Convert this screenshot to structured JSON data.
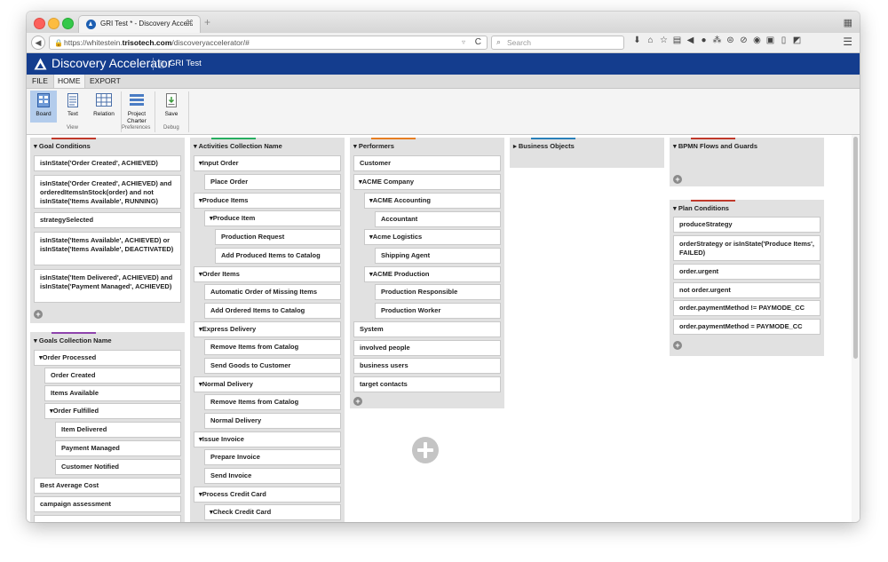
{
  "browser": {
    "tab_title": "GRI Test * - Discovery Acce...",
    "tab_close": "⌘",
    "new_tab": "+",
    "url_prefix": "https://whitestein.",
    "url_domain": "trisotech.com",
    "url_path": "/discoveryaccelerator/#",
    "search_placeholder": "Search"
  },
  "app": {
    "name": "Discovery Accelerator",
    "document": "GRI Test",
    "brand_color": "#143d8e"
  },
  "menu": {
    "items": [
      "FILE",
      "HOME",
      "EXPORT"
    ],
    "active": "HOME"
  },
  "ribbon": {
    "board": "Board",
    "text": "Text",
    "relation": "Relation",
    "charter": "Project Charter",
    "save": "Save",
    "groups": {
      "view": "View",
      "preferences": "Preferences",
      "debug": "Debug"
    }
  },
  "columns": {
    "goal_conditions": {
      "title": "Goal Conditions",
      "cards": [
        "isInState('Order Created', ACHIEVED)",
        "isInState('Order Created', ACHIEVED) and orderedItemsInStock(order) and not isInState('Items Available', RUNNING)",
        "strategySelected",
        "isInState('Items Available', ACHIEVED) or isInState('Items Available', DEACTIVATED)",
        "isInState('Item Delivered', ACHIEVED) and isInState('Payment Managed', ACHIEVED)"
      ]
    },
    "goals": {
      "title": "Goals Collection Name",
      "order_processed": "Order Processed",
      "order_created": "Order Created",
      "items_available": "Items Available",
      "order_fulfilled": "Order Fulfilled",
      "item_delivered": "Item Delivered",
      "payment_managed": "Payment Managed",
      "customer_notified": "Customer Notified",
      "best_average_cost": "Best Average Cost",
      "campaign_assessment": "campaign assessment"
    },
    "activities": {
      "title": "Activities Collection Name",
      "input_order": "Input Order",
      "place_order": "Place Order",
      "produce_items": "Produce Items",
      "produce_item": "Produce Item",
      "production_request": "Production Request",
      "add_produced": "Add Produced Items to Catalog",
      "order_items": "Order Items",
      "automatic_order": "Automatic Order of Missing Items",
      "add_ordered": "Add Ordered Items to Catalog",
      "express_delivery": "Express Delivery",
      "remove_items_1": "Remove Items from Catalog",
      "send_goods": "Send Goods to Customer",
      "normal_delivery_group": "Normal Delivery",
      "remove_items_2": "Remove Items from Catalog",
      "normal_delivery": "Normal Delivery",
      "issue_invoice": "Issue Invoice",
      "prepare_invoice": "Prepare Invoice",
      "send_invoice": "Send Invoice",
      "process_credit_card": "Process Credit Card",
      "check_credit_card": "Check Credit Card"
    },
    "performers": {
      "title": "Performers",
      "customer": "Customer",
      "acme_company": "ACME Company",
      "acme_accounting": "ACME Accounting",
      "accountant": "Accountant",
      "acme_logistics": "Acme Logistics",
      "shipping_agent": "Shipping Agent",
      "acme_production": "ACME Production",
      "production_responsible": "Production Responsible",
      "production_worker": "Production Worker",
      "system": "System",
      "involved_people": "involved people",
      "business_users": "business users",
      "target_contacts": "target contacts"
    },
    "business_objects": {
      "title": "Business Objects"
    },
    "bpmn_flows": {
      "title": "BPMN Flows and Guards"
    },
    "plan_conditions": {
      "title": "Plan Conditions",
      "cards": [
        "produceStrategy",
        "orderStrategy or isInState('Produce Items', FAILED)",
        "order.urgent",
        "not order.urgent",
        "order.paymentMethod != PAYMODE_CC",
        "order.paymentMethod = PAYMODE_CC"
      ]
    }
  },
  "column_colors": {
    "goal_conditions": "#c0392b",
    "goals": "#8e44ad",
    "activities": "#27ae60",
    "performers": "#e67e22",
    "business_objects": "#2980b9",
    "bpmn_flows": "#c0392b",
    "plan_conditions": "#c0392b"
  }
}
